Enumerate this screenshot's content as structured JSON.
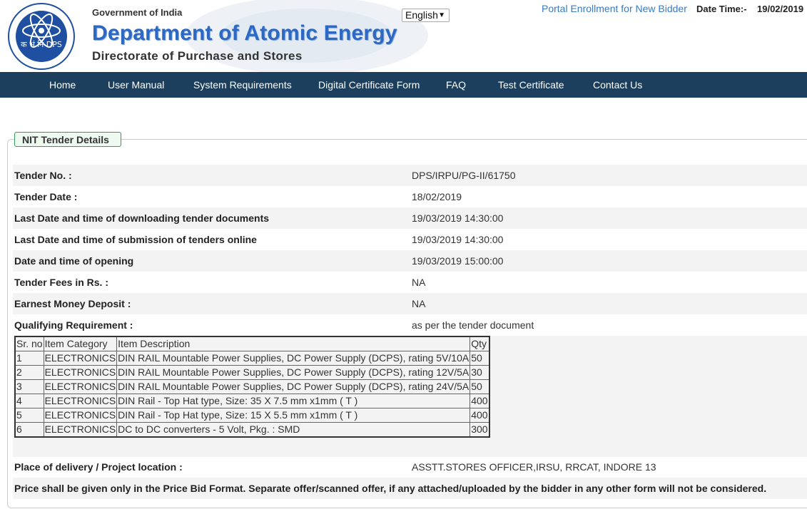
{
  "header": {
    "gov": "Government of India",
    "dept": "Department of Atomic Energy",
    "directorate": "Directorate of Purchase and Stores",
    "logo_text": "क भं नि DPS",
    "logo_ring_text": "ATOMS IN THE SERVICE OF THE NATION",
    "language": "English",
    "portal_link": "Portal Enrollment for New Bidder",
    "date_label": "Date Time:-",
    "date_value": "19/02/2019"
  },
  "nav": [
    "Home",
    "User Manual",
    "System Requirements",
    "Digital Certificate Form",
    "FAQ",
    "Test Certificate",
    "Contact Us"
  ],
  "section_title": "NIT Tender Details",
  "details": [
    {
      "label": "Tender No. :",
      "value": "DPS/IRPU/PG-II/61750"
    },
    {
      "label": "Tender Date :",
      "value": "18/02/2019"
    },
    {
      "label": "Last Date and time of downloading tender documents",
      "value": "19/03/2019 14:30:00"
    },
    {
      "label": "Last Date and time of submission of tenders online",
      "value": "19/03/2019 14:30:00"
    },
    {
      "label": "Date and time of opening",
      "value": "19/03/2019 15:00:00"
    },
    {
      "label": "Tender Fees in Rs. :",
      "value": "NA"
    },
    {
      "label": "Earnest Money Deposit :",
      "value": "NA"
    },
    {
      "label": "Qualifying Requirement :",
      "value": "as per the tender document"
    }
  ],
  "items_table": {
    "headers": [
      "Sr. no",
      "Item Category",
      "Item Description",
      "Qty"
    ],
    "rows": [
      [
        "1",
        "ELECTRONICS",
        "DIN RAIL Mountable Power Supplies, DC Power Supply (DCPS), rating 5V/10A",
        "50"
      ],
      [
        "2",
        "ELECTRONICS",
        "DIN RAIL Mountable Power Supplies, DC Power Supply (DCPS), rating 12V/5A",
        "30"
      ],
      [
        "3",
        "ELECTRONICS",
        "DIN RAIL Mountable Power Supplies, DC Power Supply (DCPS), rating 24V/5A",
        "50"
      ],
      [
        "4",
        "ELECTRONICS",
        "DIN Rail - Top Hat type, Size: 35 X 7.5 mm x1mm ( T )",
        "400"
      ],
      [
        "5",
        "ELECTRONICS",
        "DIN Rail - Top Hat type, Size: 15 X 5.5 mm x1mm ( T )",
        "400"
      ],
      [
        "6",
        "ELECTRONICS",
        "DC to DC converters - 5 Volt, Pkg. : SMD",
        "300"
      ]
    ]
  },
  "delivery": {
    "label": "Place of delivery / Project location :",
    "value": "ASSTT.STORES OFFICER,IRSU, RRCAT, INDORE 13"
  },
  "note": "Price shall be given only in the Price Bid Format. Separate offer/scanned offer, if any attached/uploaded by the bidder in any other form will not be considered.",
  "colors": {
    "nav_bg": "#1b3f5d",
    "dept_blue": "#2d68c2",
    "link_blue": "#3a7bbf"
  }
}
